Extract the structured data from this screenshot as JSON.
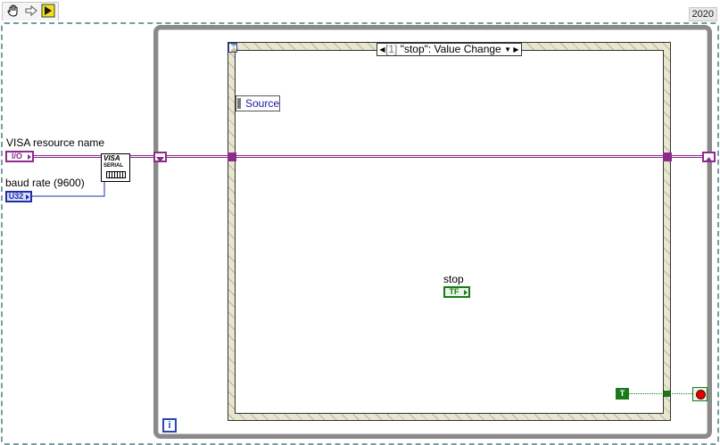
{
  "toolbar": {
    "icons": [
      "hand-tool-icon",
      "arrow-right-icon",
      "run-arrow-icon"
    ]
  },
  "version_label": "2020",
  "diagram": {
    "controls": [
      {
        "label": "VISA resource name",
        "terminal": "I/O",
        "type": "visa"
      },
      {
        "label": "baud rate (9600)",
        "terminal": "U32",
        "type": "u32"
      }
    ],
    "visa_node": {
      "title": "VISA",
      "subtitle": "SERIAL"
    },
    "event_structure": {
      "case_index": "[1]",
      "case_text": "\"stop\": Value Change",
      "event_data_node": "Source"
    },
    "stop_terminal": {
      "label": "stop",
      "terminal": "TF"
    },
    "true_constant": "T",
    "iteration_terminal": "i",
    "colors": {
      "visa_wire": "#8e2a8e",
      "numeric": "#1f2fa8",
      "boolean": "#1a7a1a",
      "loop_frame": "#8a8a8a",
      "event_frame": "#e9e6cf",
      "stop_button": "#e00000"
    }
  }
}
